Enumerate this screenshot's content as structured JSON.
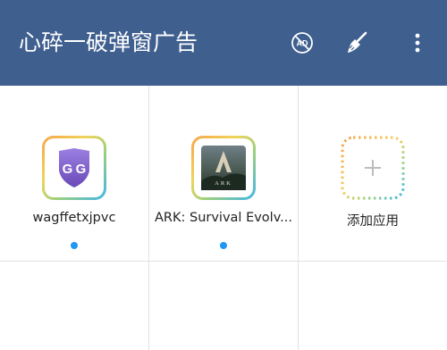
{
  "toolbar": {
    "title": "心碎一破弹窗广告",
    "background": "#3f5f8f",
    "actions": [
      {
        "icon": "ad-block-icon"
      },
      {
        "icon": "broom-icon"
      },
      {
        "icon": "more-vert-icon"
      }
    ]
  },
  "apps": [
    {
      "label": "wagffetxjpvc",
      "icon": "game-guardian-icon",
      "running_indicator_color": "#2196f3"
    },
    {
      "label": "ARK: Survival Evolv...",
      "icon": "ark-survival-icon",
      "running_indicator_color": "#2196f3"
    }
  ],
  "add_app": {
    "label": "添加应用",
    "icon": "plus-icon"
  }
}
